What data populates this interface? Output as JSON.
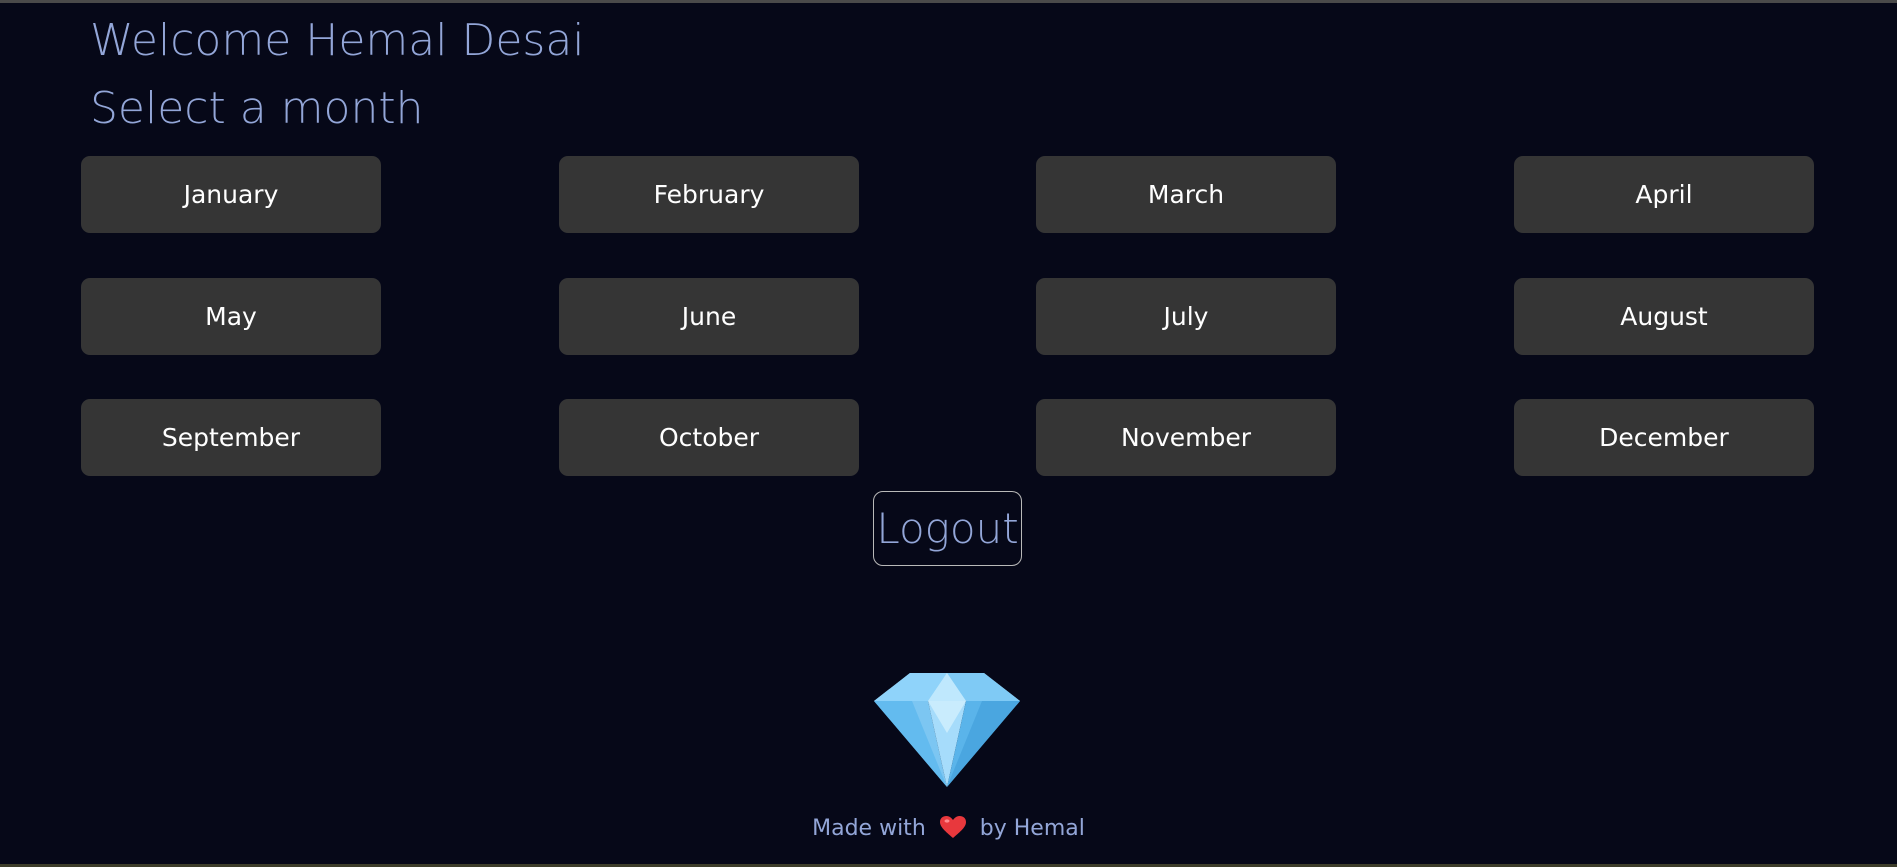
{
  "header": {
    "welcome": "Welcome Hemal Desai",
    "prompt": "Select a month"
  },
  "months": [
    "January",
    "February",
    "March",
    "April",
    "May",
    "June",
    "July",
    "August",
    "September",
    "October",
    "November",
    "December"
  ],
  "logout_label": "Logout",
  "logo": {
    "icon": "diamond-icon"
  },
  "footer": {
    "prefix": "Made with",
    "icon": "heart-icon",
    "suffix": "by Hemal"
  },
  "colors": {
    "background": "#060818",
    "heading_text": "#93a6d8",
    "button_bg": "#353535",
    "button_text": "#ffffff",
    "heart": "#e8383d",
    "diamond": "#7cc8f5"
  }
}
